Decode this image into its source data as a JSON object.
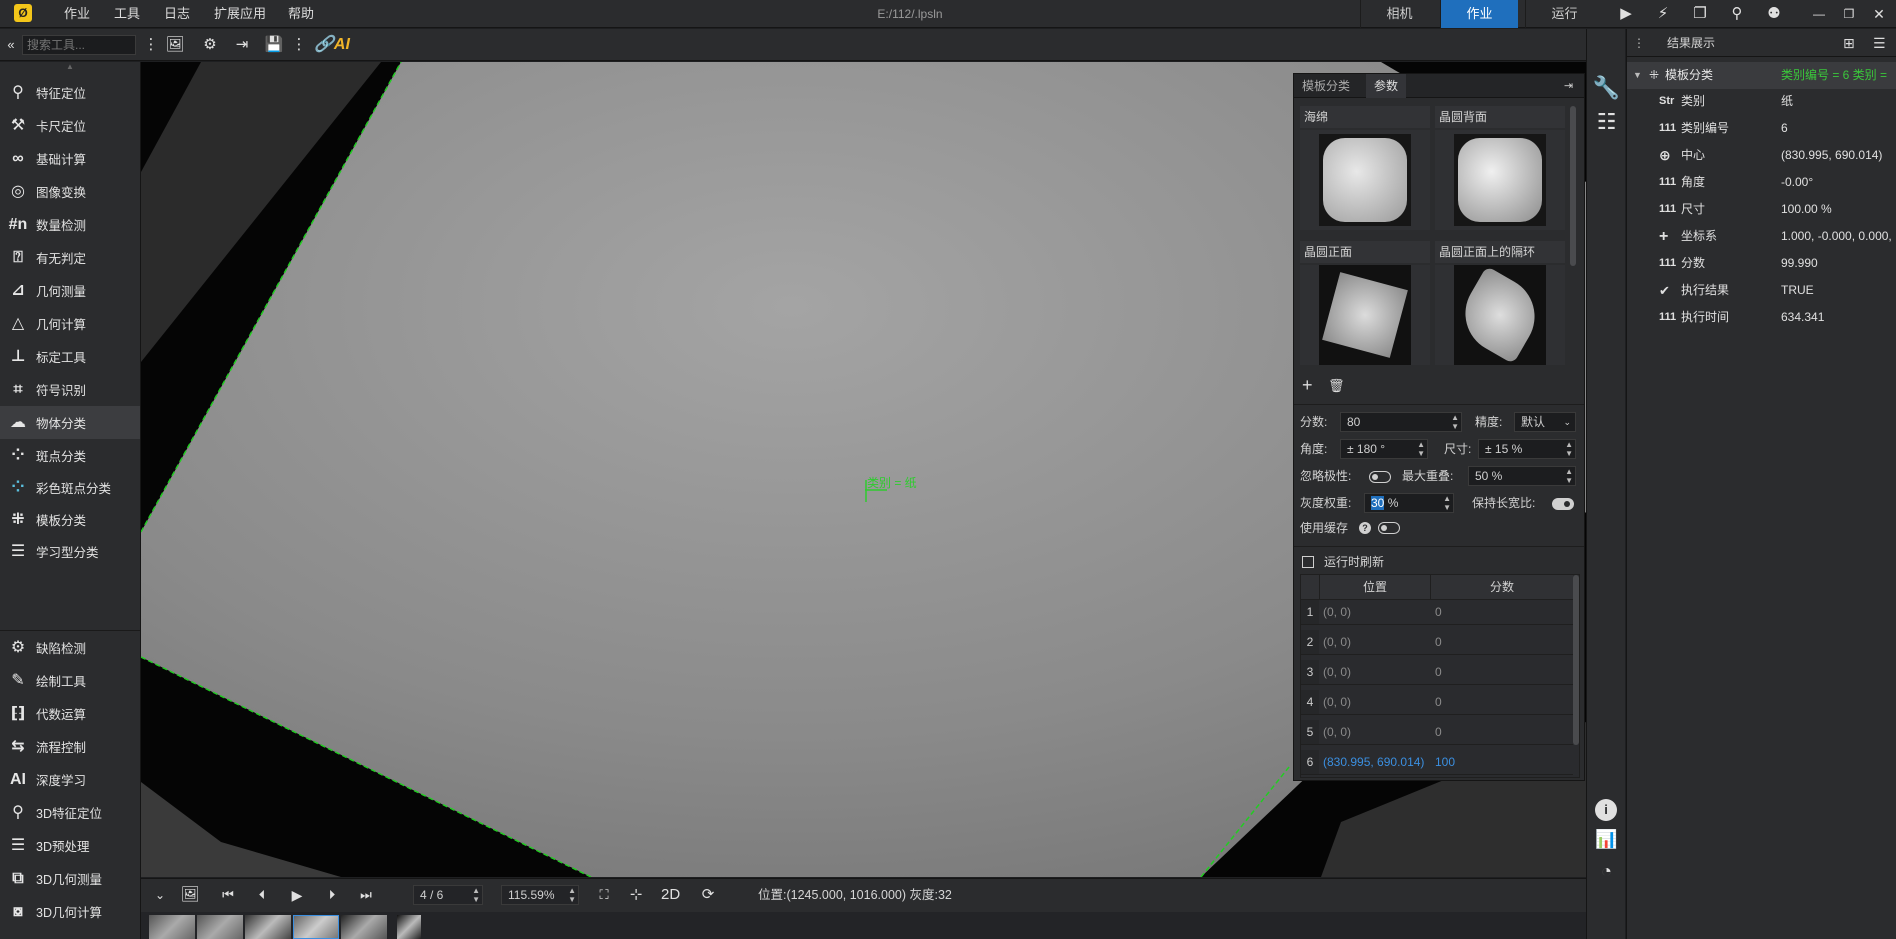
{
  "menubar": {
    "logo": "Ø",
    "menus": [
      "作业",
      "工具",
      "日志",
      "扩展应用",
      "帮助"
    ],
    "file_title": "E:/112/.lpsln",
    "modes": [
      "相机",
      "作业",
      "运行"
    ],
    "active_mode": "作业"
  },
  "toolbar": {
    "search_placeholder": "搜索工具...",
    "ai_label": "AI"
  },
  "sidebar": {
    "items": [
      {
        "label": "特征定位",
        "icon": "location-pin-icon"
      },
      {
        "label": "卡尺定位",
        "icon": "caliper-icon"
      },
      {
        "label": "基础计算",
        "icon": "infinity-icon"
      },
      {
        "label": "图像变换",
        "icon": "image-transform-icon"
      },
      {
        "label": "数量检测",
        "icon": "count-icon"
      },
      {
        "label": "有无判定",
        "icon": "presence-icon"
      },
      {
        "label": "几何测量",
        "icon": "ruler-angle-icon"
      },
      {
        "label": "几何计算",
        "icon": "geometry-icon"
      },
      {
        "label": "标定工具",
        "icon": "calibration-icon"
      },
      {
        "label": "符号识别",
        "icon": "ocr-icon"
      },
      {
        "label": "物体分类",
        "icon": "brain-icon"
      },
      {
        "label": "斑点分类",
        "icon": "blob-icon"
      },
      {
        "label": "彩色斑点分类",
        "icon": "color-blob-icon"
      },
      {
        "label": "模板分类",
        "icon": "template-icon"
      },
      {
        "label": "学习型分类",
        "icon": "learning-icon"
      }
    ],
    "items2": [
      {
        "label": "缺陷检测",
        "icon": "defect-icon"
      },
      {
        "label": "绘制工具",
        "icon": "draw-icon"
      },
      {
        "label": "代数运算",
        "icon": "algebra-icon"
      },
      {
        "label": "流程控制",
        "icon": "flow-icon"
      },
      {
        "label": "深度学习",
        "icon": "ai-icon"
      },
      {
        "label": "3D特征定位",
        "icon": "3d-location-icon"
      },
      {
        "label": "3D预处理",
        "icon": "3d-preprocess-icon"
      },
      {
        "label": "3D几何测量",
        "icon": "3d-measure-icon"
      },
      {
        "label": "3D几何计算",
        "icon": "3d-compute-icon"
      }
    ],
    "active": "物体分类"
  },
  "viewport": {
    "overlay_label": "类别 = 纸"
  },
  "params_panel": {
    "tabs": [
      "模板分类",
      "参数"
    ],
    "active_tab": "参数",
    "templates": [
      {
        "name": "海绵"
      },
      {
        "name": "晶圆背面"
      },
      {
        "name": "晶圆正面"
      },
      {
        "name": "晶圆正面上的隔环"
      }
    ],
    "fields": {
      "score_label": "分数:",
      "score_value": "80",
      "precision_label": "精度:",
      "precision_value": "默认",
      "angle_label": "角度:",
      "angle_value": "± 180 °",
      "size_label": "尺寸:",
      "size_value": "± 15 %",
      "ignore_polarity_label": "忽略极性:",
      "max_overlap_label": "最大重叠:",
      "max_overlap_value": "50 %",
      "gray_weight_label": "灰度权重:",
      "gray_weight_value": "30",
      "gray_weight_unit": "%",
      "keep_ratio_label": "保持长宽比:",
      "use_cache_label": "使用缓存"
    },
    "refresh_label": "运行时刷新",
    "table": {
      "headers": [
        "位置",
        "分数"
      ],
      "rows": [
        {
          "idx": "1",
          "pos": "(0, 0)",
          "score": "0"
        },
        {
          "idx": "2",
          "pos": "(0, 0)",
          "score": "0"
        },
        {
          "idx": "3",
          "pos": "(0, 0)",
          "score": "0"
        },
        {
          "idx": "4",
          "pos": "(0, 0)",
          "score": "0"
        },
        {
          "idx": "5",
          "pos": "(0, 0)",
          "score": "0"
        },
        {
          "idx": "6",
          "pos": "(830.995, 690.014)",
          "score": "100"
        }
      ]
    }
  },
  "bottombar": {
    "frame": "4 / 6",
    "zoom": "115.59%",
    "mode_2d": "2D",
    "status": "位置:(1245.000, 1016.000) 灰度:32"
  },
  "results": {
    "title": "结果展示",
    "root_name": "模板分类",
    "root_value": "类别编号 = 6 类别 =",
    "rows": [
      {
        "type": "Str",
        "name": "类别",
        "value": "纸"
      },
      {
        "type": "111",
        "name": "类别编号",
        "value": "6"
      },
      {
        "type": "⊕",
        "name": "中心",
        "value": "(830.995, 690.014)"
      },
      {
        "type": "111",
        "name": "角度",
        "value": "-0.00°"
      },
      {
        "type": "111",
        "name": "尺寸",
        "value": "100.00 %"
      },
      {
        "type": "+",
        "name": "坐标系",
        "value": "1.000, -0.000, 0.000,"
      },
      {
        "type": "111",
        "name": "分数",
        "value": "99.990"
      },
      {
        "type": "✔",
        "name": "执行结果",
        "value": "TRUE"
      },
      {
        "type": "111",
        "name": "执行时间",
        "value": "634.341"
      }
    ]
  },
  "colors": {
    "accent": "#1f6fbd",
    "overlay_green": "#2ecc2e",
    "root_value_green": "#3bc73b",
    "highlight_blue": "#3b8fe0"
  }
}
